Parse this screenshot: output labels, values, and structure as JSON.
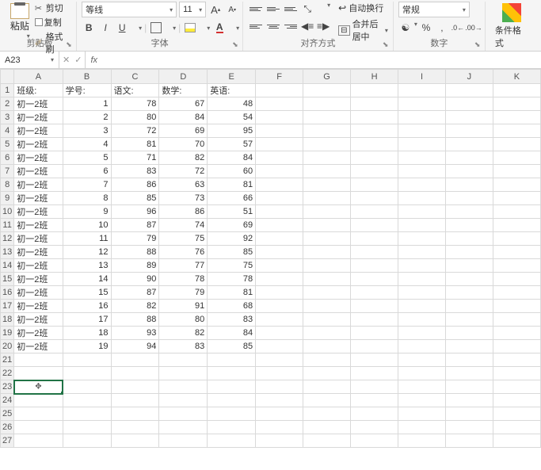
{
  "ribbon": {
    "clipboard": {
      "label": "剪贴板",
      "paste": "粘贴",
      "cut": "剪切",
      "copy": "复制",
      "format_painter": "格式刷"
    },
    "font": {
      "label": "字体",
      "name": "等线",
      "size": "11",
      "increase": "A",
      "decrease": "A"
    },
    "alignment": {
      "label": "对齐方式",
      "wrap_text": "自动换行",
      "merge_center": "合并后居中"
    },
    "number": {
      "label": "数字",
      "format": "常规"
    },
    "conditional": {
      "label": "条件格式"
    }
  },
  "formula_bar": {
    "name_box": "A23",
    "fx": "fx"
  },
  "columns": [
    "A",
    "B",
    "C",
    "D",
    "E",
    "F",
    "G",
    "H",
    "I",
    "J",
    "K"
  ],
  "headers": {
    "A": "班级:",
    "B": "学号:",
    "C": "语文:",
    "D": "数学:",
    "E": "英语:"
  },
  "chart_data": {
    "type": "table",
    "columns": [
      "班级",
      "学号",
      "语文",
      "数学",
      "英语"
    ],
    "rows": [
      [
        "初一2班",
        1,
        78,
        67,
        48
      ],
      [
        "初一2班",
        2,
        80,
        84,
        54
      ],
      [
        "初一2班",
        3,
        72,
        69,
        95
      ],
      [
        "初一2班",
        4,
        81,
        70,
        57
      ],
      [
        "初一2班",
        5,
        71,
        82,
        84
      ],
      [
        "初一2班",
        6,
        83,
        72,
        60
      ],
      [
        "初一2班",
        7,
        86,
        63,
        81
      ],
      [
        "初一2班",
        8,
        85,
        73,
        66
      ],
      [
        "初一2班",
        9,
        96,
        86,
        51
      ],
      [
        "初一2班",
        10,
        87,
        74,
        69
      ],
      [
        "初一2班",
        11,
        79,
        75,
        92
      ],
      [
        "初一2班",
        12,
        88,
        76,
        85
      ],
      [
        "初一2班",
        13,
        89,
        77,
        75
      ],
      [
        "初一2班",
        14,
        90,
        78,
        78
      ],
      [
        "初一2班",
        15,
        87,
        79,
        81
      ],
      [
        "初一2班",
        16,
        82,
        91,
        68
      ],
      [
        "初一2班",
        17,
        88,
        80,
        83
      ],
      [
        "初一2班",
        18,
        93,
        82,
        84
      ],
      [
        "初一2班",
        19,
        94,
        83,
        85
      ]
    ]
  },
  "active_cell_row": 23,
  "total_rows": 27
}
